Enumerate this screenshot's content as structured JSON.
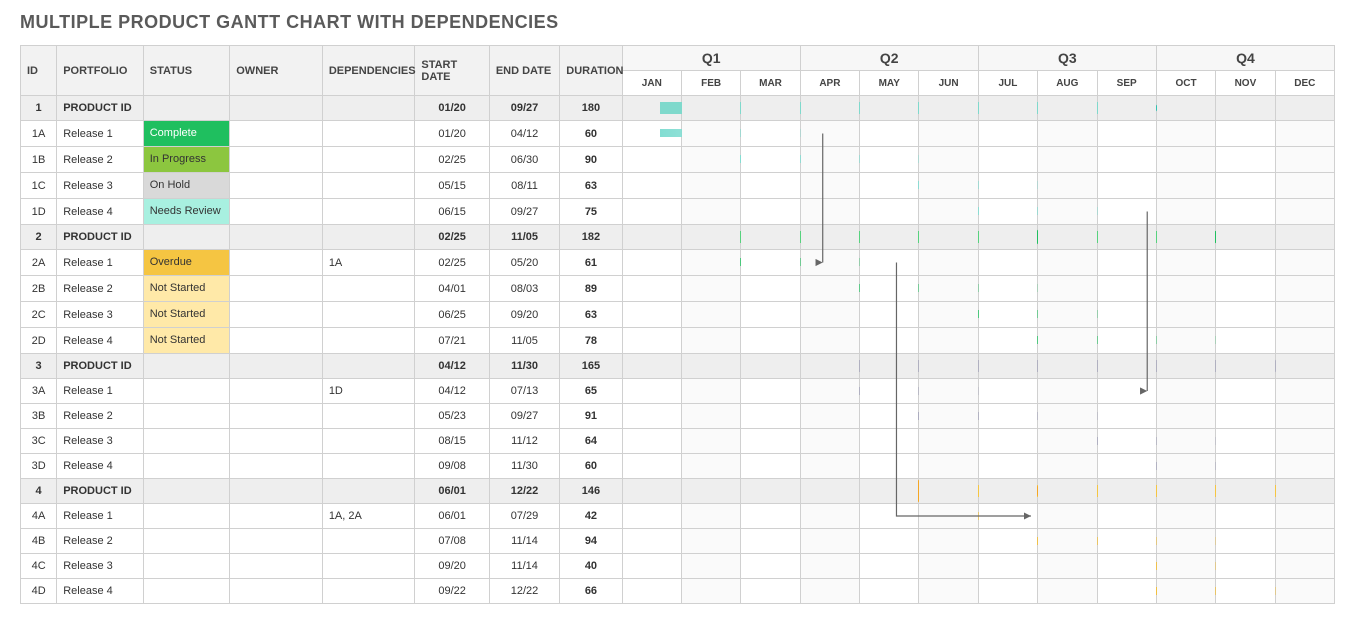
{
  "title": "MULTIPLE PRODUCT GANTT CHART WITH DEPENDENCIES",
  "headers": {
    "id": "ID",
    "portfolio": "PORTFOLIO",
    "status": "STATUS",
    "owner": "OWNER",
    "dependencies": "DEPENDENCIES",
    "start": "START DATE",
    "end": "END DATE",
    "duration": "DURATION"
  },
  "quarters": [
    "Q1",
    "Q2",
    "Q3",
    "Q4"
  ],
  "months": [
    "JAN",
    "FEB",
    "MAR",
    "APR",
    "MAY",
    "JUN",
    "JUL",
    "AUG",
    "SEP",
    "OCT",
    "NOV",
    "DEC"
  ],
  "statusLabels": {
    "complete": "Complete",
    "inprog": "In Progress",
    "onhold": "On Hold",
    "needs": "Needs Review",
    "overdue": "Overdue",
    "nstart": "Not Started"
  },
  "rows": [
    {
      "id": "1",
      "portfolio": "PRODUCT ID",
      "product": true,
      "start": "01/20",
      "end": "09/27",
      "duration": "180",
      "barStart": 0.63,
      "barEnd": 8.9,
      "color": "#7fd9cc",
      "ms": [
        3.4,
        5.5,
        8.9
      ],
      "msColor": "#33c1b0"
    },
    {
      "id": "1A",
      "portfolio": "Release 1",
      "status": "complete",
      "start": "01/20",
      "end": "04/12",
      "duration": "60",
      "barStart": 0.63,
      "barEnd": 3.4,
      "grad": "fade1"
    },
    {
      "id": "1B",
      "portfolio": "Release 2",
      "status": "inprog",
      "start": "02/25",
      "end": "06/30",
      "duration": "90",
      "barStart": 1.85,
      "barEnd": 5.97,
      "grad": "fade1"
    },
    {
      "id": "1C",
      "portfolio": "Release 3",
      "status": "onhold",
      "start": "05/15",
      "end": "08/11",
      "duration": "63",
      "barStart": 4.47,
      "barEnd": 7.35,
      "grad": "fade1"
    },
    {
      "id": "1D",
      "portfolio": "Release 4",
      "status": "needs",
      "start": "06/15",
      "end": "09/27",
      "duration": "75",
      "barStart": 5.47,
      "barEnd": 8.9,
      "grad": "fade1"
    },
    {
      "id": "2",
      "portfolio": "PRODUCT ID",
      "product": true,
      "start": "02/25",
      "end": "11/05",
      "duration": "182",
      "barStart": 1.85,
      "barEnd": 10.15,
      "color": "#57d27e",
      "ms": [
        4.65,
        7.1,
        10.15
      ],
      "msColor": "#1fbf5f"
    },
    {
      "id": "2A",
      "portfolio": "Release 1",
      "status": "overdue",
      "dep": "1A",
      "start": "02/25",
      "end": "05/20",
      "duration": "61",
      "barStart": 1.85,
      "barEnd": 4.65,
      "grad": "fade2"
    },
    {
      "id": "2B",
      "portfolio": "Release 2",
      "status": "nstart",
      "start": "04/01",
      "end": "08/03",
      "duration": "89",
      "barStart": 3.03,
      "barEnd": 7.1,
      "grad": "fade2"
    },
    {
      "id": "2C",
      "portfolio": "Release 3",
      "status": "nstart",
      "start": "06/25",
      "end": "09/20",
      "duration": "63",
      "barStart": 5.8,
      "barEnd": 8.65,
      "grad": "fade2"
    },
    {
      "id": "2D",
      "portfolio": "Release 4",
      "status": "nstart",
      "start": "07/21",
      "end": "11/05",
      "duration": "78",
      "barStart": 6.68,
      "barEnd": 10.15,
      "grad": "fade2"
    },
    {
      "id": "3",
      "portfolio": "PRODUCT ID",
      "product": true,
      "start": "04/12",
      "end": "11/30",
      "duration": "165",
      "barStart": 3.4,
      "barEnd": 10.97,
      "color": "#b0b0c0",
      "ms": [
        3.4,
        8.9,
        10.97
      ],
      "msColor": "#b0b0c0"
    },
    {
      "id": "3A",
      "portfolio": "Release 1",
      "dep": "1D",
      "start": "04/12",
      "end": "07/13",
      "duration": "65",
      "barStart": 3.4,
      "barEnd": 6.4,
      "grad": "fade3"
    },
    {
      "id": "3B",
      "portfolio": "Release 2",
      "start": "05/23",
      "end": "09/27",
      "duration": "91",
      "barStart": 4.73,
      "barEnd": 8.9,
      "grad": "fade3"
    },
    {
      "id": "3C",
      "portfolio": "Release 3",
      "start": "08/15",
      "end": "11/12",
      "duration": "64",
      "barStart": 7.47,
      "barEnd": 10.4,
      "grad": "fade3"
    },
    {
      "id": "3D",
      "portfolio": "Release 4",
      "start": "09/08",
      "end": "11/30",
      "duration": "60",
      "barStart": 8.25,
      "barEnd": 10.97,
      "grad": "fade3"
    },
    {
      "id": "4",
      "portfolio": "PRODUCT ID",
      "product": true,
      "start": "06/01",
      "end": "12/22",
      "duration": "146",
      "barStart": 5.03,
      "barEnd": 11.7,
      "color": "#f5c542",
      "ms": [
        5.03,
        6.93,
        11.7
      ],
      "msColor": "#f5a623"
    },
    {
      "id": "4A",
      "portfolio": "Release 1",
      "dep": "1A, 2A",
      "start": "06/01",
      "end": "07/29",
      "duration": "42",
      "barStart": 5.03,
      "barEnd": 6.93,
      "grad": "fade4"
    },
    {
      "id": "4B",
      "portfolio": "Release 2",
      "start": "07/08",
      "end": "11/14",
      "duration": "94",
      "barStart": 6.25,
      "barEnd": 10.47,
      "grad": "fade4"
    },
    {
      "id": "4C",
      "portfolio": "Release 3",
      "start": "09/20",
      "end": "11/14",
      "duration": "40",
      "barStart": 8.65,
      "barEnd": 10.47,
      "grad": "fade4"
    },
    {
      "id": "4D",
      "portfolio": "Release 4",
      "start": "09/22",
      "end": "12/22",
      "duration": "66",
      "barStart": 8.72,
      "barEnd": 11.7,
      "grad": "fade4"
    }
  ],
  "dependencies": [
    {
      "fromRow": 1,
      "fromX": 3.4,
      "toRow": 6,
      "toX": 3.4,
      "jog": 3.4
    },
    {
      "fromRow": 4,
      "fromX": 8.9,
      "toRow": 11,
      "toX": 8.9,
      "jog": 8.9
    },
    {
      "fromRow": 6,
      "fromX": 4.65,
      "toRow": 16,
      "toX": 6.93,
      "jog": 4.65
    }
  ],
  "chart_data": {
    "type": "gantt",
    "title": "Multiple Product Gantt Chart with Dependencies",
    "x_axis": {
      "unit": "month",
      "categories": [
        "JAN",
        "FEB",
        "MAR",
        "APR",
        "MAY",
        "JUN",
        "JUL",
        "AUG",
        "SEP",
        "OCT",
        "NOV",
        "DEC"
      ],
      "quarters": [
        "Q1",
        "Q2",
        "Q3",
        "Q4"
      ]
    },
    "tasks": [
      {
        "id": "1",
        "name": "PRODUCT ID",
        "type": "summary",
        "start": "01/20",
        "end": "09/27",
        "duration_days": 180,
        "milestones": [
          "04/12",
          "06/15",
          "09/27"
        ]
      },
      {
        "id": "1A",
        "name": "Release 1",
        "parent": "1",
        "status": "Complete",
        "start": "01/20",
        "end": "04/12",
        "duration_days": 60
      },
      {
        "id": "1B",
        "name": "Release 2",
        "parent": "1",
        "status": "In Progress",
        "start": "02/25",
        "end": "06/30",
        "duration_days": 90
      },
      {
        "id": "1C",
        "name": "Release 3",
        "parent": "1",
        "status": "On Hold",
        "start": "05/15",
        "end": "08/11",
        "duration_days": 63
      },
      {
        "id": "1D",
        "name": "Release 4",
        "parent": "1",
        "status": "Needs Review",
        "start": "06/15",
        "end": "09/27",
        "duration_days": 75
      },
      {
        "id": "2",
        "name": "PRODUCT ID",
        "type": "summary",
        "start": "02/25",
        "end": "11/05",
        "duration_days": 182,
        "milestones": [
          "05/20",
          "08/03",
          "11/05"
        ]
      },
      {
        "id": "2A",
        "name": "Release 1",
        "parent": "2",
        "status": "Overdue",
        "depends_on": [
          "1A"
        ],
        "start": "02/25",
        "end": "05/20",
        "duration_days": 61
      },
      {
        "id": "2B",
        "name": "Release 2",
        "parent": "2",
        "status": "Not Started",
        "start": "04/01",
        "end": "08/03",
        "duration_days": 89
      },
      {
        "id": "2C",
        "name": "Release 3",
        "parent": "2",
        "status": "Not Started",
        "start": "06/25",
        "end": "09/20",
        "duration_days": 63
      },
      {
        "id": "2D",
        "name": "Release 4",
        "parent": "2",
        "status": "Not Started",
        "start": "07/21",
        "end": "11/05",
        "duration_days": 78
      },
      {
        "id": "3",
        "name": "PRODUCT ID",
        "type": "summary",
        "start": "04/12",
        "end": "11/30",
        "duration_days": 165,
        "milestones": [
          "04/12",
          "09/27",
          "11/30"
        ]
      },
      {
        "id": "3A",
        "name": "Release 1",
        "parent": "3",
        "depends_on": [
          "1D"
        ],
        "start": "04/12",
        "end": "07/13",
        "duration_days": 65
      },
      {
        "id": "3B",
        "name": "Release 2",
        "parent": "3",
        "start": "05/23",
        "end": "09/27",
        "duration_days": 91
      },
      {
        "id": "3C",
        "name": "Release 3",
        "parent": "3",
        "start": "08/15",
        "end": "11/12",
        "duration_days": 64
      },
      {
        "id": "3D",
        "name": "Release 4",
        "parent": "3",
        "start": "09/08",
        "end": "11/30",
        "duration_days": 60
      },
      {
        "id": "4",
        "name": "PRODUCT ID",
        "type": "summary",
        "start": "06/01",
        "end": "12/22",
        "duration_days": 146,
        "milestones": [
          "06/01",
          "07/29",
          "12/22"
        ]
      },
      {
        "id": "4A",
        "name": "Release 1",
        "parent": "4",
        "depends_on": [
          "1A",
          "2A"
        ],
        "start": "06/01",
        "end": "07/29",
        "duration_days": 42
      },
      {
        "id": "4B",
        "name": "Release 2",
        "parent": "4",
        "start": "07/08",
        "end": "11/14",
        "duration_days": 94
      },
      {
        "id": "4C",
        "name": "Release 3",
        "parent": "4",
        "start": "09/20",
        "end": "11/14",
        "duration_days": 40
      },
      {
        "id": "4D",
        "name": "Release 4",
        "parent": "4",
        "start": "09/22",
        "end": "12/22",
        "duration_days": 66
      }
    ],
    "dependencies": [
      {
        "from": "1A",
        "to": "2A"
      },
      {
        "from": "1D",
        "to": "3A"
      },
      {
        "from": "1A",
        "to": "4A"
      },
      {
        "from": "2A",
        "to": "4A"
      }
    ]
  }
}
